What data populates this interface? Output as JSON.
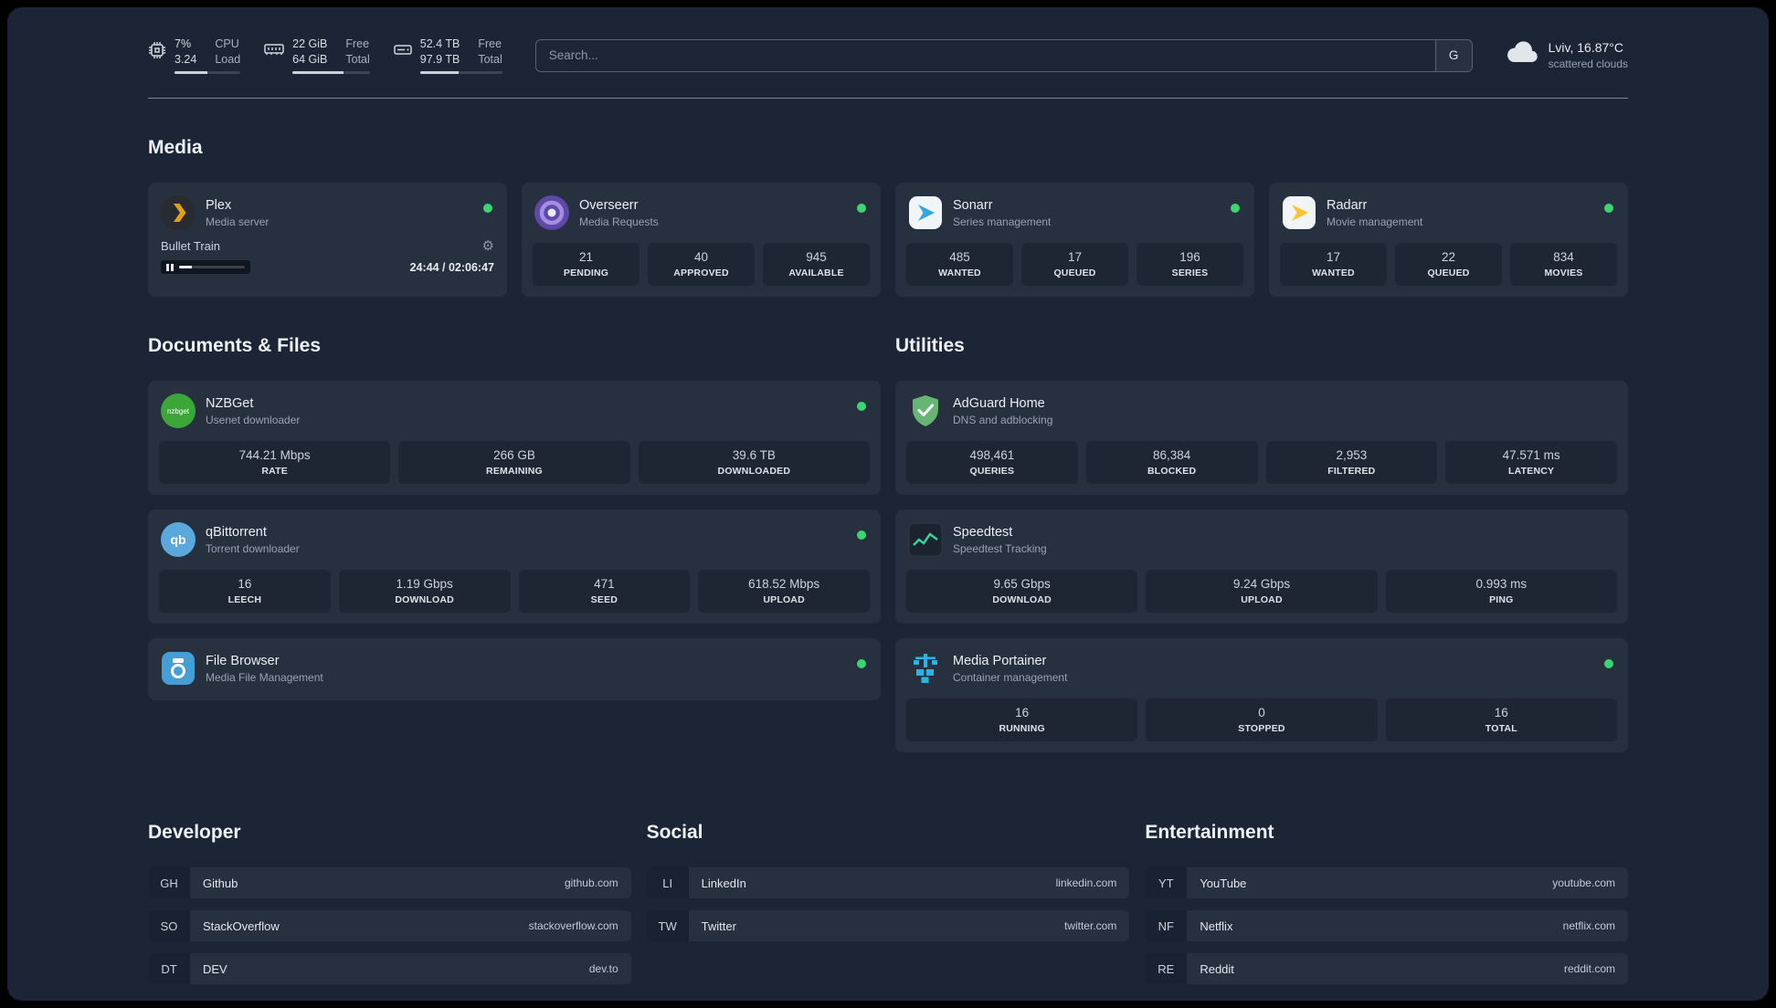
{
  "topbar": {
    "cpu": {
      "value_top": "7%",
      "value_bottom": "3.24",
      "label_top": "CPU",
      "label_bottom": "Load",
      "progress": 50
    },
    "memory": {
      "value_top": "22 GiB",
      "value_bottom": "64 GiB",
      "label_top": "Free",
      "label_bottom": "Total",
      "progress": 66
    },
    "disk": {
      "value_top": "52.4 TB",
      "value_bottom": "97.9 TB",
      "label_top": "Free",
      "label_bottom": "Total",
      "progress": 47
    },
    "search": {
      "placeholder": "Search...",
      "button": "G"
    },
    "weather": {
      "location": "Lviv, 16.87°C",
      "condition": "scattered clouds"
    }
  },
  "media": {
    "heading": "Media",
    "cards": [
      {
        "name": "Plex",
        "subtitle": "Media server",
        "online": true,
        "player": {
          "title": "Bullet Train",
          "time": "24:44 / 02:06:47",
          "progress_pct": 19,
          "state": "paused"
        }
      },
      {
        "name": "Overseerr",
        "subtitle": "Media Requests",
        "online": true,
        "stats": [
          {
            "value": "21",
            "label": "PENDING"
          },
          {
            "value": "40",
            "label": "APPROVED"
          },
          {
            "value": "945",
            "label": "AVAILABLE"
          }
        ]
      },
      {
        "name": "Sonarr",
        "subtitle": "Series management",
        "online": true,
        "stats": [
          {
            "value": "485",
            "label": "WANTED"
          },
          {
            "value": "17",
            "label": "QUEUED"
          },
          {
            "value": "196",
            "label": "SERIES"
          }
        ]
      },
      {
        "name": "Radarr",
        "subtitle": "Movie management",
        "online": true,
        "stats": [
          {
            "value": "17",
            "label": "WANTED"
          },
          {
            "value": "22",
            "label": "QUEUED"
          },
          {
            "value": "834",
            "label": "MOVIES"
          }
        ]
      }
    ]
  },
  "documents": {
    "heading": "Documents & Files",
    "cards": [
      {
        "name": "NZBGet",
        "subtitle": "Usenet downloader",
        "online": true,
        "stats": [
          {
            "value": "744.21 Mbps",
            "label": "RATE"
          },
          {
            "value": "266 GB",
            "label": "REMAINING"
          },
          {
            "value": "39.6 TB",
            "label": "DOWNLOADED"
          }
        ]
      },
      {
        "name": "qBittorrent",
        "subtitle": "Torrent downloader",
        "online": true,
        "stats": [
          {
            "value": "16",
            "label": "LEECH"
          },
          {
            "value": "1.19 Gbps",
            "label": "DOWNLOAD"
          },
          {
            "value": "471",
            "label": "SEED"
          },
          {
            "value": "618.52 Mbps",
            "label": "UPLOAD"
          }
        ]
      },
      {
        "name": "File Browser",
        "subtitle": "Media File Management",
        "online": true
      }
    ]
  },
  "utilities": {
    "heading": "Utilities",
    "cards": [
      {
        "name": "AdGuard Home",
        "subtitle": "DNS and adblocking",
        "stats": [
          {
            "value": "498,461",
            "label": "QUERIES"
          },
          {
            "value": "86,384",
            "label": "BLOCKED"
          },
          {
            "value": "2,953",
            "label": "FILTERED"
          },
          {
            "value": "47.571 ms",
            "label": "LATENCY"
          }
        ]
      },
      {
        "name": "Speedtest",
        "subtitle": "Speedtest Tracking",
        "stats": [
          {
            "value": "9.65 Gbps",
            "label": "DOWNLOAD"
          },
          {
            "value": "9.24 Gbps",
            "label": "UPLOAD"
          },
          {
            "value": "0.993 ms",
            "label": "PING"
          }
        ]
      },
      {
        "name": "Media Portainer",
        "subtitle": "Container management",
        "online": true,
        "stats": [
          {
            "value": "16",
            "label": "RUNNING"
          },
          {
            "value": "0",
            "label": "STOPPED"
          },
          {
            "value": "16",
            "label": "TOTAL"
          }
        ]
      }
    ]
  },
  "bookmarks": {
    "developer": {
      "heading": "Developer",
      "items": [
        {
          "abbr": "GH",
          "name": "Github",
          "domain": "github.com"
        },
        {
          "abbr": "SO",
          "name": "StackOverflow",
          "domain": "stackoverflow.com"
        },
        {
          "abbr": "DT",
          "name": "DEV",
          "domain": "dev.to"
        }
      ]
    },
    "social": {
      "heading": "Social",
      "items": [
        {
          "abbr": "LI",
          "name": "LinkedIn",
          "domain": "linkedin.com"
        },
        {
          "abbr": "TW",
          "name": "Twitter",
          "domain": "twitter.com"
        }
      ]
    },
    "entertainment": {
      "heading": "Entertainment",
      "items": [
        {
          "abbr": "YT",
          "name": "YouTube",
          "domain": "youtube.com"
        },
        {
          "abbr": "NF",
          "name": "Netflix",
          "domain": "netflix.com"
        },
        {
          "abbr": "RE",
          "name": "Reddit",
          "domain": "reddit.com"
        }
      ]
    }
  },
  "icons": {
    "gear": "⚙",
    "nzbget_text": "nzbget",
    "qb_text": "qb"
  },
  "colors": {
    "status_online": "#3bd671",
    "plex_accent": "#e5a00d",
    "overseerr_accent": "#5e48a8",
    "sonarr_accent": "#36a6e3",
    "radarr_accent": "#ffc230",
    "nzbget_accent": "#3da639",
    "qbittorrent_accent": "#5ba8dc",
    "adguard_accent": "#66b574",
    "speedtest_accent": "#38d39f",
    "filebrowser_accent": "#459ed8",
    "portainer_accent": "#2bb3e6"
  }
}
